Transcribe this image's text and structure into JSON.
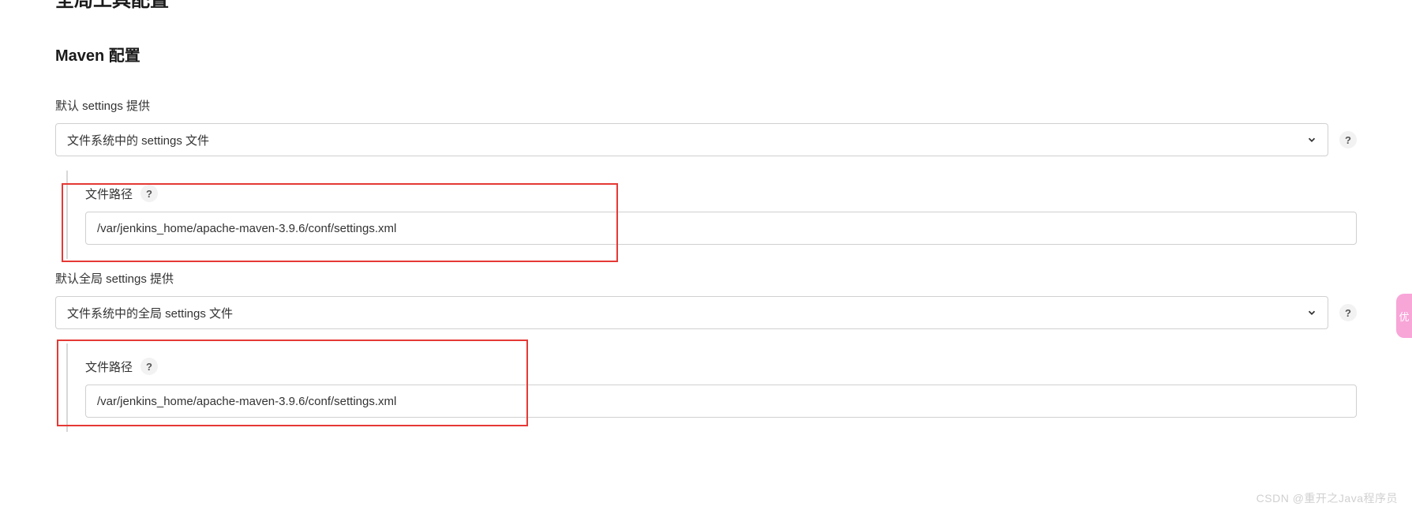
{
  "page": {
    "title": "全局工具配置"
  },
  "section": {
    "title": "Maven 配置"
  },
  "defaultSettings": {
    "label": "默认 settings 提供",
    "selected": "文件系统中的 settings 文件",
    "nested": {
      "label": "文件路径",
      "value": "/var/jenkins_home/apache-maven-3.9.6/conf/settings.xml"
    }
  },
  "defaultGlobalSettings": {
    "label": "默认全局 settings 提供",
    "selected": "文件系统中的全局 settings 文件",
    "nested": {
      "label": "文件路径",
      "value": "/var/jenkins_home/apache-maven-3.9.6/conf/settings.xml"
    }
  },
  "help": "?",
  "watermark": "CSDN @重开之Java程序员",
  "sideTab": "优"
}
